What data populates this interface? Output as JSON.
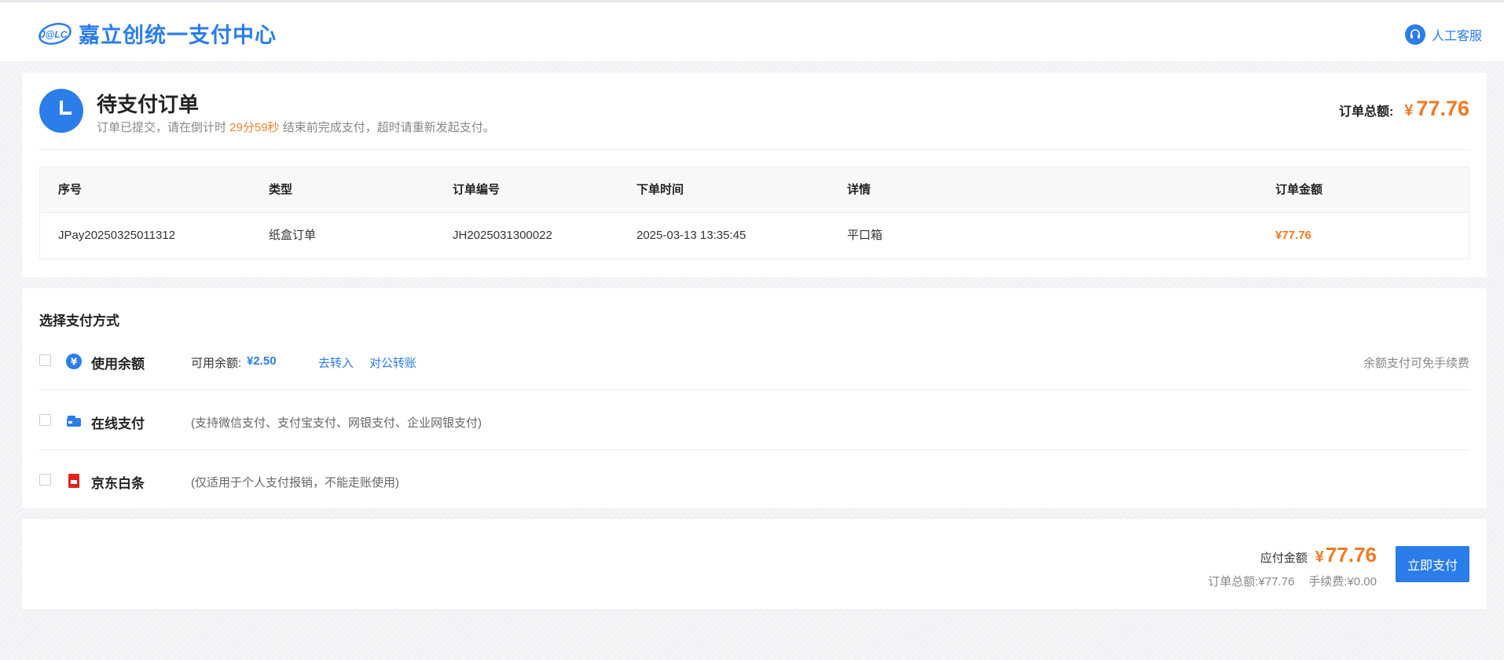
{
  "header": {
    "logo_text": "J@LC",
    "title": "嘉立创统一支付中心",
    "service_label": "人工客服"
  },
  "order": {
    "title": "待支付订单",
    "notice_before": "订单已提交，请在倒计时 ",
    "countdown": "29分59秒",
    "notice_after": " 结束前完成支付，超时请重新发起支付。",
    "total_label": "订单总额:",
    "total_currency": "¥",
    "total_amount": "77.76"
  },
  "table": {
    "columns": [
      "序号",
      "类型",
      "订单编号",
      "下单时间",
      "详情",
      "订单金额"
    ],
    "rows": [
      {
        "seq": "JPay20250325011312",
        "type": "纸盒订单",
        "order_no": "JH2025031300022",
        "time": "2025-03-13 13:35:45",
        "detail": "平口箱",
        "amount": "¥77.76"
      }
    ]
  },
  "payment": {
    "title": "选择支付方式",
    "methods": [
      {
        "name": "使用余额",
        "icon": "yuan-coin-icon",
        "balance_label": "可用余额:",
        "balance_value": "¥2.50",
        "links": [
          "去转入",
          "对公转账"
        ],
        "note": "余额支付可免手续费",
        "checked": false
      },
      {
        "name": "在线支付",
        "icon": "wallet-icon",
        "desc": "(支持微信支付、支付宝支付、网银支付、企业网银支付)",
        "checked": false
      },
      {
        "name": "京东白条",
        "icon": "jd-baitiao-icon",
        "desc": "(仅适用于个人支付报销，不能走账使用)",
        "checked": false
      }
    ]
  },
  "summary": {
    "payable_label": "应付金额",
    "payable_currency": "¥",
    "payable_amount": "77.76",
    "order_total_text": "订单总额:¥77.76",
    "fee_text": "手续费:¥0.00",
    "pay_button": "立即支付"
  },
  "colors": {
    "primary": "#2b7de9",
    "accent_orange": "#f07a22",
    "jd_red": "#e1251b"
  }
}
